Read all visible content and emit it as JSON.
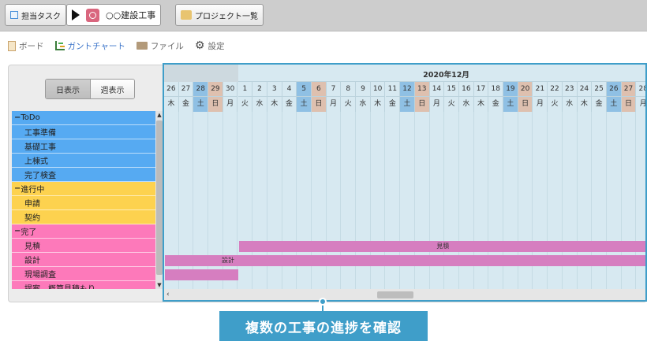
{
  "toolbar": {
    "assigned_tasks_label": "担当タスク",
    "project_name": "○○建設工事",
    "project_list_label": "プロジェクト一覧"
  },
  "tabs": [
    {
      "label": "ボード",
      "icon": "board-icon",
      "active": false
    },
    {
      "label": "ガントチャート",
      "icon": "gantt-chart-icon",
      "active": true
    },
    {
      "label": "ファイル",
      "icon": "folder-icon",
      "active": false
    },
    {
      "label": "設定",
      "icon": "gear-icon",
      "active": false
    }
  ],
  "view_toggle": {
    "day_label": "日表示",
    "week_label": "週表示",
    "selected": "day"
  },
  "tree": [
    {
      "label": "ToDo",
      "group": true,
      "color": "blue"
    },
    {
      "label": "工事準備",
      "group": false,
      "color": "blue"
    },
    {
      "label": "基礎工事",
      "group": false,
      "color": "blue"
    },
    {
      "label": "上棟式",
      "group": false,
      "color": "blue"
    },
    {
      "label": "完了検査",
      "group": false,
      "color": "blue"
    },
    {
      "label": "進行中",
      "group": true,
      "color": "yellow"
    },
    {
      "label": "申請",
      "group": false,
      "color": "yellow"
    },
    {
      "label": "契約",
      "group": false,
      "color": "yellow"
    },
    {
      "label": "完了",
      "group": true,
      "color": "pink"
    },
    {
      "label": "見積",
      "group": false,
      "color": "pink"
    },
    {
      "label": "設計",
      "group": false,
      "color": "pink"
    },
    {
      "label": "現場調査",
      "group": false,
      "color": "pink"
    },
    {
      "label": "提案　概算見積もり",
      "group": false,
      "color": "pink"
    }
  ],
  "gantt": {
    "month_label": "2020年12月",
    "days": [
      {
        "n": "26",
        "w": "木",
        "t": ""
      },
      {
        "n": "27",
        "w": "金",
        "t": ""
      },
      {
        "n": "28",
        "w": "土",
        "t": "sat"
      },
      {
        "n": "29",
        "w": "日",
        "t": "sun"
      },
      {
        "n": "30",
        "w": "月",
        "t": ""
      },
      {
        "n": "1",
        "w": "火",
        "t": ""
      },
      {
        "n": "2",
        "w": "水",
        "t": ""
      },
      {
        "n": "3",
        "w": "木",
        "t": ""
      },
      {
        "n": "4",
        "w": "金",
        "t": ""
      },
      {
        "n": "5",
        "w": "土",
        "t": "sat"
      },
      {
        "n": "6",
        "w": "日",
        "t": "sun"
      },
      {
        "n": "7",
        "w": "月",
        "t": ""
      },
      {
        "n": "8",
        "w": "火",
        "t": ""
      },
      {
        "n": "9",
        "w": "水",
        "t": ""
      },
      {
        "n": "10",
        "w": "木",
        "t": ""
      },
      {
        "n": "11",
        "w": "金",
        "t": ""
      },
      {
        "n": "12",
        "w": "土",
        "t": "sat"
      },
      {
        "n": "13",
        "w": "日",
        "t": "sun"
      },
      {
        "n": "14",
        "w": "月",
        "t": ""
      },
      {
        "n": "15",
        "w": "火",
        "t": ""
      },
      {
        "n": "16",
        "w": "水",
        "t": ""
      },
      {
        "n": "17",
        "w": "木",
        "t": ""
      },
      {
        "n": "18",
        "w": "金",
        "t": ""
      },
      {
        "n": "19",
        "w": "土",
        "t": "sat"
      },
      {
        "n": "20",
        "w": "日",
        "t": "sun"
      },
      {
        "n": "21",
        "w": "月",
        "t": ""
      },
      {
        "n": "22",
        "w": "火",
        "t": ""
      },
      {
        "n": "23",
        "w": "水",
        "t": ""
      },
      {
        "n": "24",
        "w": "木",
        "t": ""
      },
      {
        "n": "25",
        "w": "金",
        "t": ""
      },
      {
        "n": "26",
        "w": "土",
        "t": "sat"
      },
      {
        "n": "27",
        "w": "日",
        "t": "sun"
      },
      {
        "n": "28",
        "w": "月",
        "t": ""
      }
    ],
    "bars": [
      {
        "label": "見積",
        "row": 9,
        "start": 5,
        "end": 33
      },
      {
        "label": "設計",
        "row": 10,
        "start": 0,
        "end": 33
      },
      {
        "label": "",
        "row": 11,
        "start": 0,
        "end": 5
      }
    ]
  },
  "caption": "複数の工事の進捗を確認",
  "colors": {
    "blue": "#56aaf2",
    "yellow": "#fdd24f",
    "pink": "#fd79ba",
    "bar": "#d67ec0",
    "accent": "#3f9ec9"
  }
}
